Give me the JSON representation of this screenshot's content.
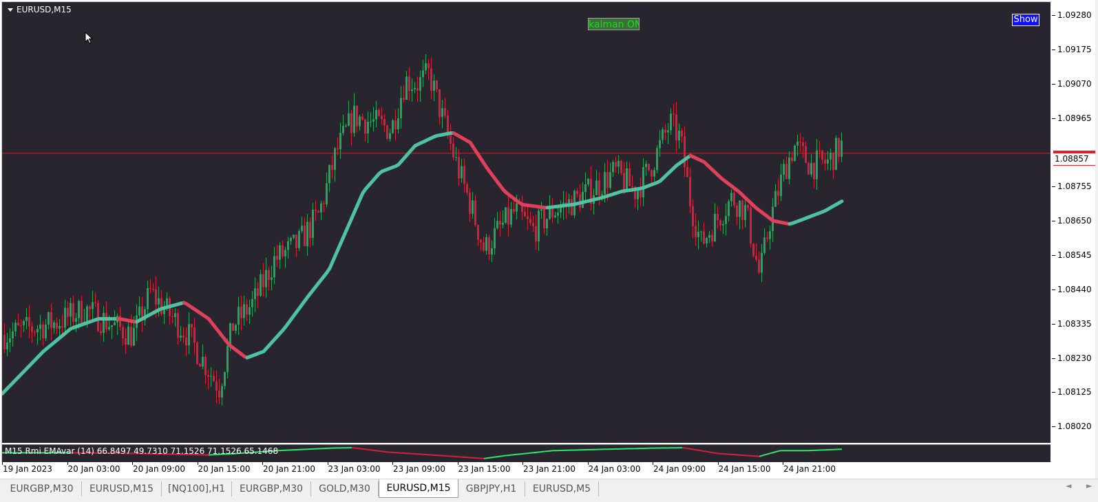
{
  "chart": {
    "title": "EURUSD,M15",
    "kalman_label": "kalman ON",
    "show_button": "Show",
    "current_price": "1.08857",
    "colors": {
      "background": "#28252f",
      "bull": "#1fa85a",
      "bear": "#d81f3a",
      "kalman_up": "#4fc3a1",
      "kalman_down": "#e0405a",
      "price_line": "#c8242f"
    }
  },
  "price_axis": {
    "labels": [
      "1.09280",
      "1.09175",
      "1.09070",
      "1.08965",
      "1.08755",
      "1.08650",
      "1.08545",
      "1.08440",
      "1.08335",
      "1.08230",
      "1.08125",
      "1.08020"
    ]
  },
  "time_axis": {
    "labels": [
      "19 Jan 2023",
      "20 Jan 03:00",
      "20 Jan 09:00",
      "20 Jan 15:00",
      "20 Jan 21:00",
      "23 Jan 03:00",
      "23 Jan 09:00",
      "23 Jan 15:00",
      "23 Jan 21:00",
      "24 Jan 03:00",
      "24 Jan 09:00",
      "24 Jan 15:00",
      "24 Jan 21:00"
    ]
  },
  "subwindow": {
    "label": "M15 Rmi EMAvar (14) 66.8497 49.7310 71.1526 71.1526 65.1468",
    "scale_max": "99.866",
    "scale_min": "11.9793"
  },
  "tabs": [
    {
      "label": "EURGBP,M30",
      "active": false
    },
    {
      "label": "EURUSD,M15",
      "active": false
    },
    {
      "label": "[NQ100],H1",
      "active": false
    },
    {
      "label": "EURGBP,M30",
      "active": false
    },
    {
      "label": "GOLD,M30",
      "active": false
    },
    {
      "label": "EURUSD,M15",
      "active": true
    },
    {
      "label": "GBPJPY,H1",
      "active": false
    },
    {
      "label": "EURUSD,M5",
      "active": false
    }
  ],
  "tab_scroll": {
    "left": "◄",
    "right": "►"
  },
  "chart_data": {
    "type": "candlestick",
    "symbol": "EURUSD",
    "timeframe": "M15",
    "ylim": [
      1.0797,
      1.0932
    ],
    "price_line": 1.08857,
    "kalman_anchors": [
      [
        0,
        1.0812
      ],
      [
        60,
        1.0825
      ],
      [
        100,
        1.0832
      ],
      [
        140,
        1.0835
      ],
      [
        170,
        1.0835
      ],
      [
        195,
        1.0834
      ],
      [
        230,
        1.0838
      ],
      [
        265,
        1.084
      ],
      [
        300,
        1.0835
      ],
      [
        330,
        1.0827
      ],
      [
        355,
        1.0823
      ],
      [
        380,
        1.0825
      ],
      [
        410,
        1.0832
      ],
      [
        445,
        1.0842
      ],
      [
        475,
        1.085
      ],
      [
        500,
        1.0862
      ],
      [
        525,
        1.0874
      ],
      [
        550,
        1.088
      ],
      [
        575,
        1.0882
      ],
      [
        600,
        1.0888
      ],
      [
        630,
        1.0891
      ],
      [
        655,
        1.0892
      ],
      [
        680,
        1.0889
      ],
      [
        705,
        1.0881
      ],
      [
        730,
        1.0874
      ],
      [
        755,
        1.087
      ],
      [
        790,
        1.0869
      ],
      [
        830,
        1.087
      ],
      [
        870,
        1.0872
      ],
      [
        900,
        1.0874
      ],
      [
        930,
        1.0875
      ],
      [
        955,
        1.0877
      ],
      [
        980,
        1.0882
      ],
      [
        1000,
        1.0885
      ],
      [
        1020,
        1.0883
      ],
      [
        1045,
        1.0878
      ],
      [
        1070,
        1.0874
      ],
      [
        1095,
        1.0869
      ],
      [
        1120,
        1.0865
      ],
      [
        1145,
        1.0864
      ],
      [
        1170,
        1.0866
      ],
      [
        1195,
        1.0868
      ],
      [
        1220,
        1.0871
      ]
    ],
    "price_anchors": [
      [
        0,
        1.083
      ],
      [
        40,
        1.0832
      ],
      [
        80,
        1.0834
      ],
      [
        120,
        1.0838
      ],
      [
        160,
        1.0833
      ],
      [
        190,
        1.083
      ],
      [
        215,
        1.0843
      ],
      [
        240,
        1.0837
      ],
      [
        270,
        1.083
      ],
      [
        295,
        1.0821
      ],
      [
        315,
        1.0814
      ],
      [
        335,
        1.0833
      ],
      [
        365,
        1.084
      ],
      [
        395,
        1.0853
      ],
      [
        430,
        1.0858
      ],
      [
        460,
        1.0867
      ],
      [
        485,
        1.0886
      ],
      [
        510,
        1.0897
      ],
      [
        540,
        1.0895
      ],
      [
        565,
        1.0893
      ],
      [
        585,
        1.0908
      ],
      [
        605,
        1.0907
      ],
      [
        620,
        1.091
      ],
      [
        640,
        1.0896
      ],
      [
        660,
        1.0882
      ],
      [
        680,
        1.087
      ],
      [
        700,
        1.0856
      ],
      [
        720,
        1.0862
      ],
      [
        745,
        1.0868
      ],
      [
        770,
        1.0862
      ],
      [
        800,
        1.0868
      ],
      [
        830,
        1.0871
      ],
      [
        860,
        1.0875
      ],
      [
        890,
        1.088
      ],
      [
        920,
        1.0874
      ],
      [
        945,
        1.0883
      ],
      [
        970,
        1.0895
      ],
      [
        985,
        1.089
      ],
      [
        1000,
        1.087
      ],
      [
        1015,
        1.0858
      ],
      [
        1040,
        1.0866
      ],
      [
        1060,
        1.0872
      ],
      [
        1080,
        1.0868
      ],
      [
        1100,
        1.0848
      ],
      [
        1115,
        1.0865
      ],
      [
        1135,
        1.088
      ],
      [
        1150,
        1.0888
      ],
      [
        1175,
        1.0882
      ],
      [
        1200,
        1.0883
      ],
      [
        1218,
        1.0888
      ]
    ],
    "rmi_anchors": [
      [
        0,
        55
      ],
      [
        100,
        55
      ],
      [
        200,
        50
      ],
      [
        250,
        45
      ],
      [
        300,
        40
      ],
      [
        340,
        50
      ],
      [
        400,
        70
      ],
      [
        480,
        88
      ],
      [
        510,
        90
      ],
      [
        560,
        60
      ],
      [
        640,
        35
      ],
      [
        700,
        15
      ],
      [
        730,
        35
      ],
      [
        800,
        70
      ],
      [
        880,
        80
      ],
      [
        950,
        88
      ],
      [
        990,
        90
      ],
      [
        1040,
        50
      ],
      [
        1100,
        30
      ],
      [
        1130,
        70
      ],
      [
        1170,
        70
      ],
      [
        1220,
        80
      ]
    ]
  }
}
